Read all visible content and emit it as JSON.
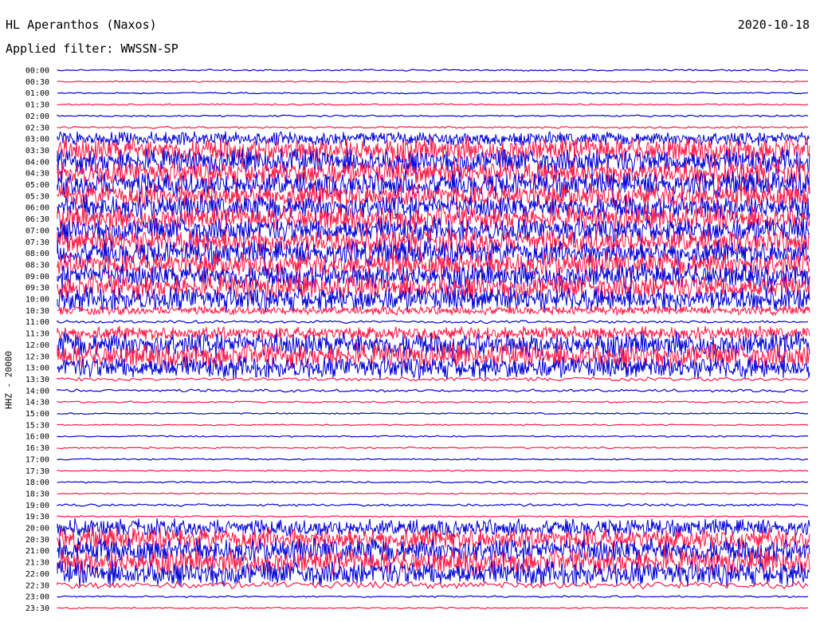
{
  "header": {
    "station": "HL Aperanthos (Naxos)",
    "date": "2020-10-18",
    "filter": "Applied filter: WWSSN-SP",
    "channel": "HHZ - 20000"
  },
  "colors": {
    "red": "#ff1744",
    "blue": "#0000d8"
  },
  "chart_data": {
    "type": "line",
    "title": "HL Aperanthos (Naxos)",
    "subtitle": "Applied filter: WWSSN-SP",
    "ylabel": "HHZ - 20000",
    "xlabel": "",
    "rows": [
      {
        "label": "00:00",
        "color": "blue",
        "activity": 0.05
      },
      {
        "label": "00:30",
        "color": "red",
        "activity": 0.03
      },
      {
        "label": "01:00",
        "color": "blue",
        "activity": 0.06
      },
      {
        "label": "01:30",
        "color": "red",
        "activity": 0.06
      },
      {
        "label": "02:00",
        "color": "blue",
        "activity": 0.05
      },
      {
        "label": "02:30",
        "color": "red",
        "activity": 0.08
      },
      {
        "label": "03:00",
        "color": "blue",
        "activity": 0.55
      },
      {
        "label": "03:30",
        "color": "red",
        "activity": 1.0
      },
      {
        "label": "04:00",
        "color": "blue",
        "activity": 1.0
      },
      {
        "label": "04:30",
        "color": "red",
        "activity": 1.0
      },
      {
        "label": "05:00",
        "color": "blue",
        "activity": 1.0
      },
      {
        "label": "05:30",
        "color": "red",
        "activity": 1.0
      },
      {
        "label": "06:00",
        "color": "blue",
        "activity": 1.0
      },
      {
        "label": "06:30",
        "color": "red",
        "activity": 1.0
      },
      {
        "label": "07:00",
        "color": "blue",
        "activity": 1.0
      },
      {
        "label": "07:30",
        "color": "red",
        "activity": 1.0
      },
      {
        "label": "08:00",
        "color": "blue",
        "activity": 1.0
      },
      {
        "label": "08:30",
        "color": "red",
        "activity": 1.0
      },
      {
        "label": "09:00",
        "color": "blue",
        "activity": 1.0
      },
      {
        "label": "09:30",
        "color": "red",
        "activity": 1.0
      },
      {
        "label": "10:00",
        "color": "blue",
        "activity": 1.0
      },
      {
        "label": "10:30",
        "color": "red",
        "activity": 0.35
      },
      {
        "label": "11:00",
        "color": "blue",
        "activity": 0.12
      },
      {
        "label": "11:30",
        "color": "red",
        "activity": 0.55
      },
      {
        "label": "12:00",
        "color": "blue",
        "activity": 1.0
      },
      {
        "label": "12:30",
        "color": "red",
        "activity": 1.0
      },
      {
        "label": "13:00",
        "color": "blue",
        "activity": 0.9
      },
      {
        "label": "13:30",
        "color": "red",
        "activity": 0.15
      },
      {
        "label": "14:00",
        "color": "blue",
        "activity": 0.12
      },
      {
        "label": "14:30",
        "color": "red",
        "activity": 0.05
      },
      {
        "label": "15:00",
        "color": "blue",
        "activity": 0.06
      },
      {
        "label": "15:30",
        "color": "red",
        "activity": 0.03
      },
      {
        "label": "16:00",
        "color": "blue",
        "activity": 0.04
      },
      {
        "label": "16:30",
        "color": "red",
        "activity": 0.05
      },
      {
        "label": "17:00",
        "color": "blue",
        "activity": 0.04
      },
      {
        "label": "17:30",
        "color": "red",
        "activity": 0.03
      },
      {
        "label": "18:00",
        "color": "blue",
        "activity": 0.05
      },
      {
        "label": "18:30",
        "color": "red",
        "activity": 0.03
      },
      {
        "label": "19:00",
        "color": "blue",
        "activity": 0.1
      },
      {
        "label": "19:30",
        "color": "red",
        "activity": 0.06
      },
      {
        "label": "20:00",
        "color": "blue",
        "activity": 0.7
      },
      {
        "label": "20:30",
        "color": "red",
        "activity": 0.9
      },
      {
        "label": "21:00",
        "color": "blue",
        "activity": 1.0
      },
      {
        "label": "21:30",
        "color": "red",
        "activity": 1.0
      },
      {
        "label": "22:00",
        "color": "blue",
        "activity": 1.0
      },
      {
        "label": "22:30",
        "color": "red",
        "activity": 0.3
      },
      {
        "label": "23:00",
        "color": "blue",
        "activity": 0.05
      },
      {
        "label": "23:30",
        "color": "red",
        "activity": 0.04
      }
    ]
  }
}
